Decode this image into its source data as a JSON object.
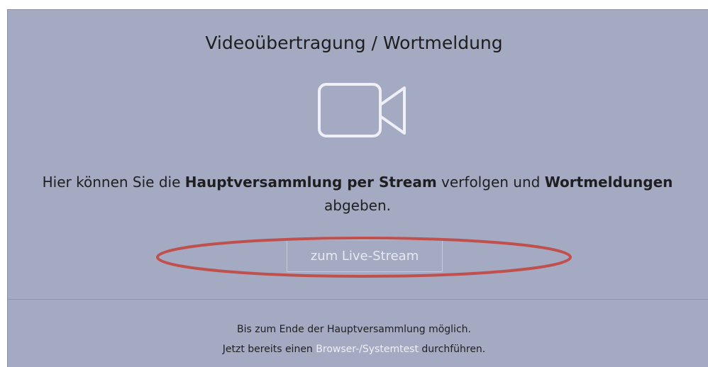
{
  "title": "Videoübertragung / Wortmeldung",
  "icons": {
    "video": "video-camera-icon"
  },
  "description": {
    "part1": "Hier können Sie die ",
    "bold1": "Hauptversammlung per Stream",
    "part2": " verfolgen und ",
    "bold2": "Wortmeldungen",
    "part3": " abgeben."
  },
  "live_button": {
    "label": "zum Live-Stream"
  },
  "footer": {
    "line1": "Bis zum Ende der Hauptversammlung möglich.",
    "line2_prefix": "Jetzt bereits einen ",
    "line2_link": "Browser-/Systemtest",
    "line2_suffix": " durchführen."
  },
  "colors": {
    "panel": "#a4aac2",
    "annotation": "#c0504d",
    "link": "#eef0f6"
  }
}
